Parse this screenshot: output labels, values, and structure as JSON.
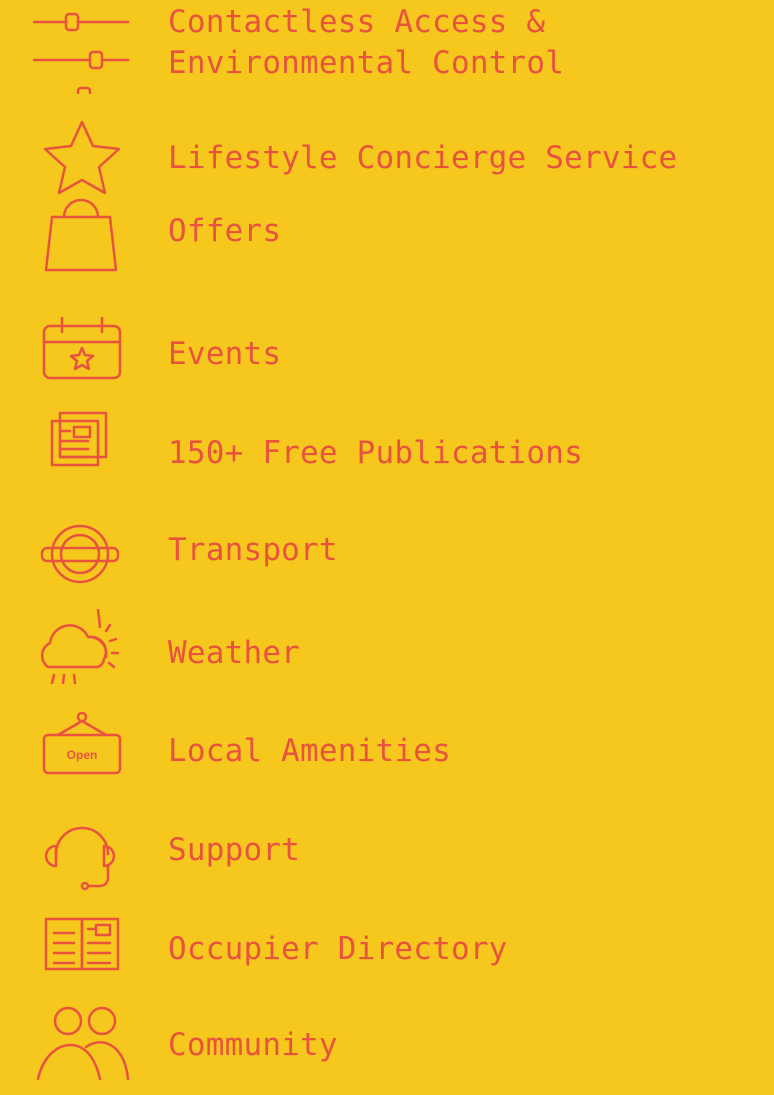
{
  "colors": {
    "background": "#F6C81E",
    "accent": "#E8533E"
  },
  "features": [
    {
      "icon": "sliders-icon",
      "lines": [
        "Contactless Access &",
        "Environmental Control"
      ]
    },
    {
      "icon": "star-icon",
      "label": "Lifestyle Concierge Service"
    },
    {
      "icon": "shopping-bag-icon",
      "label": "Offers"
    },
    {
      "icon": "calendar-star-icon",
      "label": "Events"
    },
    {
      "icon": "newspaper-icon",
      "label": "150+ Free Publications"
    },
    {
      "icon": "transport-roundel-icon",
      "label": "Transport"
    },
    {
      "icon": "cloud-sun-icon",
      "label": "Weather"
    },
    {
      "icon": "open-sign-icon",
      "label": "Local Amenities",
      "sign_text": "Open"
    },
    {
      "icon": "headset-icon",
      "label": "Support"
    },
    {
      "icon": "open-book-icon",
      "label": "Occupier Directory"
    },
    {
      "icon": "people-icon",
      "label": "Community"
    }
  ]
}
